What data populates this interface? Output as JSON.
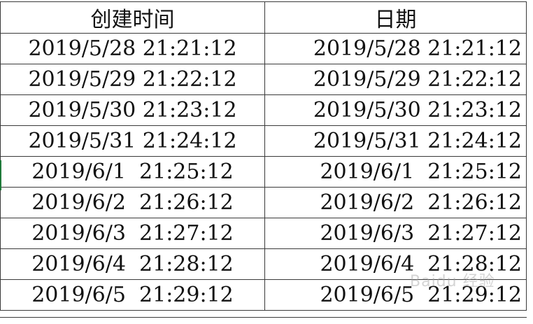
{
  "headers": {
    "created": "创建时间",
    "date": "日期"
  },
  "rows": [
    {
      "created": "2019/5/28 21:21:12",
      "date": "2019/5/28 21:21:12"
    },
    {
      "created": "2019/5/29 21:22:12",
      "date": "2019/5/29 21:22:12"
    },
    {
      "created": "2019/5/30 21:23:12",
      "date": "2019/5/30 21:23:12"
    },
    {
      "created": "2019/5/31 21:24:12",
      "date": "2019/5/31 21:24:12"
    },
    {
      "created": "2019/6/1  21:25:12",
      "date": "2019/6/1  21:25:12"
    },
    {
      "created": "2019/6/2  21:26:12",
      "date": "2019/6/2  21:26:12"
    },
    {
      "created": "2019/6/3  21:27:12",
      "date": "2019/6/3  21:27:12"
    },
    {
      "created": "2019/6/4  21:28:12",
      "date": "2019/6/4  21:28:12"
    },
    {
      "created": "2019/6/5  21:29:12",
      "date": "2019/6/5  21:29:12"
    }
  ],
  "watermark": "Baidu 经验",
  "colors": {
    "gridline": "#3a3a3a",
    "text": "#111111",
    "selection_marker": "#1f7a3a"
  }
}
